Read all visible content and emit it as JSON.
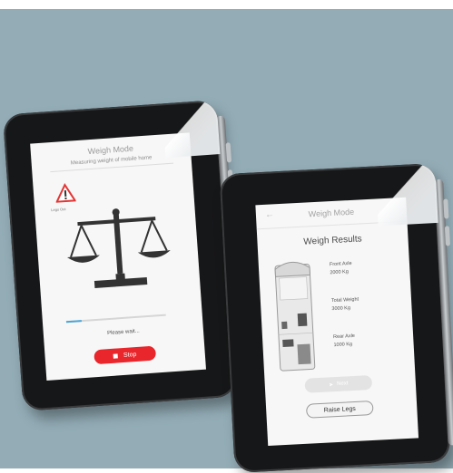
{
  "colors": {
    "background": "#93acb6",
    "bezel": "#161718",
    "stop_red": "#e8262c",
    "progress_blue": "#4aa5d6"
  },
  "weigh_mode_screen": {
    "title": "Weigh Mode",
    "subtitle": "Measuring weight of mobile home",
    "warning_icon": "warning-triangle-icon",
    "warning_label": "Legs Out",
    "scale_icon": "balance-scale-icon",
    "progress": 0.15,
    "please_wait": "Please wait...",
    "stop_label": "Stop"
  },
  "results_screen": {
    "title": "Weigh Mode",
    "back_icon": "back-arrow-icon",
    "heading": "Weigh Results",
    "front_axle_label": "Front Axle",
    "front_axle_value": "2000 Kg",
    "total_weight_label": "Total Weight",
    "total_weight_value": "3000 Kg",
    "rear_axle_label": "Rear Axle",
    "rear_axle_value": "1000 Kg",
    "next_label": "Next",
    "raise_legs_label": "Raise Legs"
  }
}
